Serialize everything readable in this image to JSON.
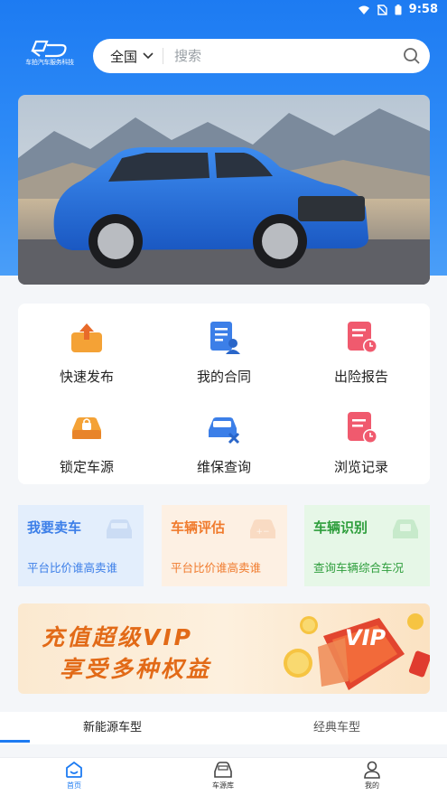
{
  "status_bar": {
    "time": "9:58"
  },
  "brand": {
    "logo_text": "车拍汽车服务科技"
  },
  "search": {
    "region": "全国",
    "placeholder": "搜索"
  },
  "quick_actions": [
    {
      "label": "快速发布",
      "icon": "upload-box-icon"
    },
    {
      "label": "我的合同",
      "icon": "contract-icon"
    },
    {
      "label": "出险报告",
      "icon": "report-clock-icon"
    },
    {
      "label": "锁定车源",
      "icon": "locked-car-icon"
    },
    {
      "label": "维保查询",
      "icon": "car-repair-icon"
    },
    {
      "label": "浏览记录",
      "icon": "history-icon"
    }
  ],
  "features": [
    {
      "title": "我要卖车",
      "subtitle": "平台比价谁高卖谁",
      "color": "#3b7ee8",
      "bg": "#e3eefc"
    },
    {
      "title": "车辆评估",
      "subtitle": "平台比价谁高卖谁",
      "color": "#f07a2c",
      "bg": "#fdf0e3"
    },
    {
      "title": "车辆识别",
      "subtitle": "查询车辆综合车况",
      "color": "#2e9e3c",
      "bg": "#e6f7e7"
    }
  ],
  "vip_banner": {
    "line1": "充值超级VIP",
    "line2": "享受多种权益",
    "badge": "VIP"
  },
  "tabs": [
    {
      "label": "新能源车型",
      "active": true
    },
    {
      "label": "经典车型",
      "active": false
    }
  ],
  "bottom_nav": [
    {
      "label": "首页",
      "icon": "home-icon",
      "active": true
    },
    {
      "label": "车源库",
      "icon": "car-source-icon",
      "active": false
    },
    {
      "label": "我的",
      "icon": "profile-icon",
      "active": false
    }
  ],
  "colors": {
    "primary": "#1d7bf2",
    "accent_orange": "#f07a2c",
    "accent_green": "#2e9e3c"
  }
}
